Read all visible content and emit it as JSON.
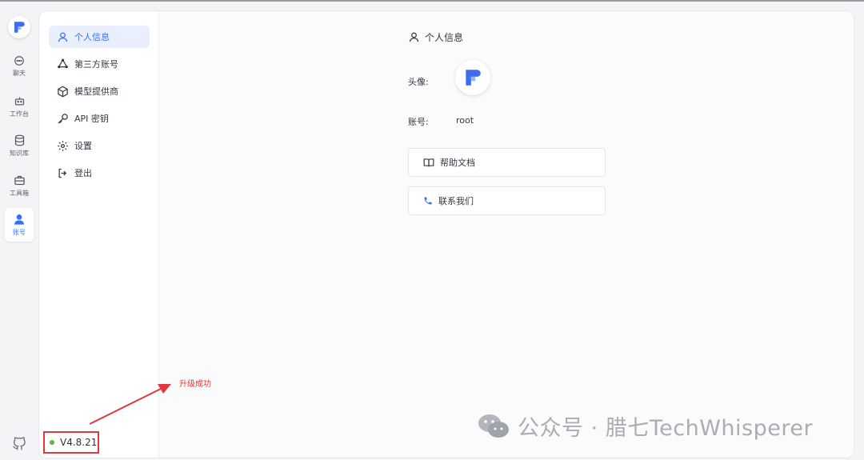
{
  "rail": {
    "items": [
      {
        "label": "聊天",
        "icon": "chat-icon"
      },
      {
        "label": "工作台",
        "icon": "robot-icon"
      },
      {
        "label": "知识库",
        "icon": "database-icon"
      },
      {
        "label": "工具箱",
        "icon": "toolbox-icon"
      },
      {
        "label": "账号",
        "icon": "user-icon",
        "active": true
      }
    ]
  },
  "subnav": {
    "items": [
      {
        "label": "个人信息",
        "icon": "user-outline-icon",
        "active": true
      },
      {
        "label": "第三方账号",
        "icon": "share-icon"
      },
      {
        "label": "模型提供商",
        "icon": "model-icon"
      },
      {
        "label": "API 密钥",
        "icon": "key-icon"
      },
      {
        "label": "设置",
        "icon": "gear-icon"
      },
      {
        "label": "登出",
        "icon": "logout-icon"
      }
    ]
  },
  "version": {
    "label": "V4.8.21",
    "status_color": "#55b93a"
  },
  "profile": {
    "title": "个人信息",
    "avatar_label": "头像:",
    "account_label": "账号:",
    "account_value": "root",
    "help_label": "帮助文档",
    "contact_label": "联系我们"
  },
  "annotation": {
    "text": "升级成功",
    "color": "#e0383e"
  },
  "watermark": {
    "text": "公众号 · 腊七TechWhisperer"
  },
  "colors": {
    "accent": "#3370ff",
    "annotation": "#e0383e"
  }
}
